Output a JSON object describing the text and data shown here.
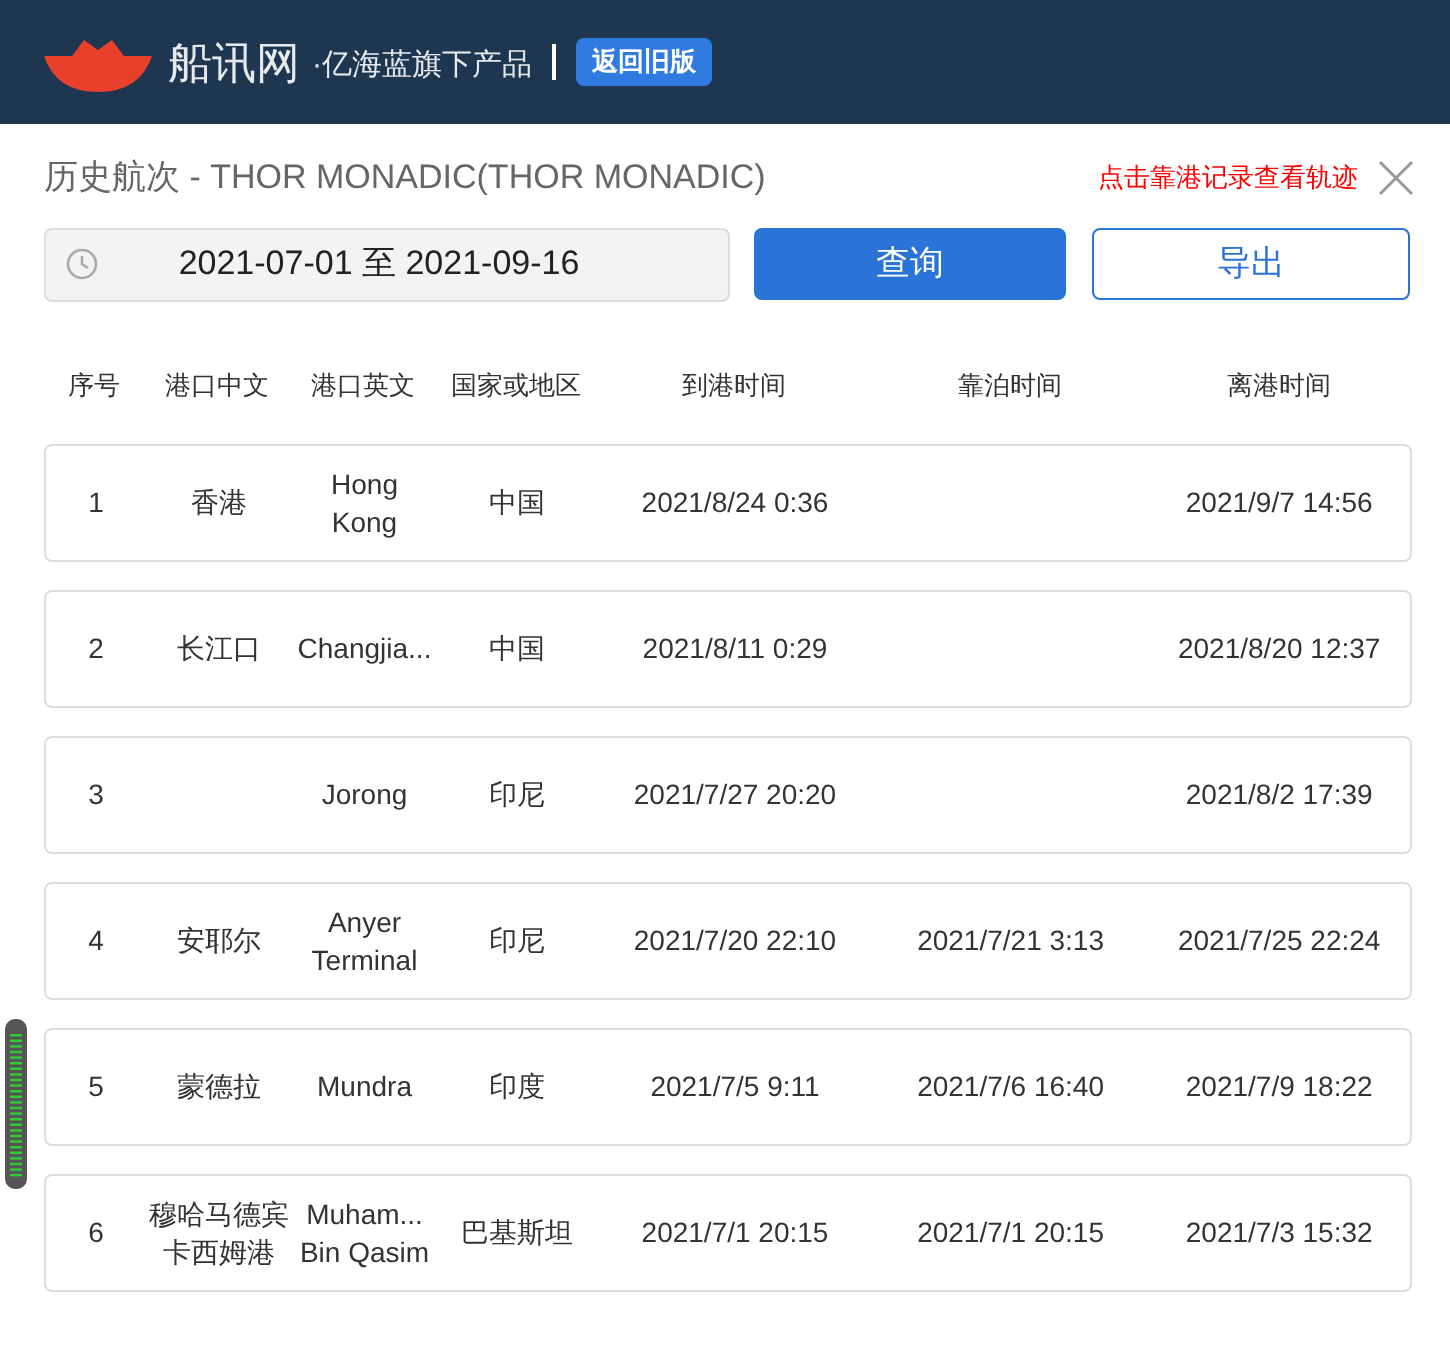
{
  "header": {
    "brand": "船讯网",
    "tagline": "·亿海蓝旗下产品",
    "old_version_button": "返回旧版"
  },
  "title": "历史航次 - THOR MONADIC(THOR MONADIC)",
  "track_hint": "点击靠港记录查看轨迹",
  "date_range": "2021-07-01 至 2021-09-16",
  "query_button": "查询",
  "export_button": "导出",
  "columns": [
    "序号",
    "港口中文",
    "港口英文",
    "国家或地区",
    "到港时间",
    "靠泊时间",
    "离港时间"
  ],
  "rows": [
    [
      "1",
      "香港",
      "Hong\nKong",
      "中国",
      "2021/8/24 0:36",
      "",
      "2021/9/7 14:56"
    ],
    [
      "2",
      "长江口",
      "Changjia...",
      "中国",
      "2021/8/11 0:29",
      "",
      "2021/8/20 12:37"
    ],
    [
      "3",
      "",
      "Jorong",
      "印尼",
      "2021/7/27 20:20",
      "",
      "2021/8/2 17:39"
    ],
    [
      "4",
      "安耶尔",
      "Anyer\nTerminal",
      "印尼",
      "2021/7/20 22:10",
      "2021/7/21 3:13",
      "2021/7/25 22:24"
    ],
    [
      "5",
      "蒙德拉",
      "Mundra",
      "印度",
      "2021/7/5 9:11",
      "2021/7/6 16:40",
      "2021/7/9 18:22"
    ],
    [
      "6",
      "穆哈马德宾卡西姆港",
      "Muham...\nBin Qasim",
      "巴基斯坦",
      "2021/7/1 20:15",
      "2021/7/1 20:15",
      "2021/7/3 15:32"
    ]
  ]
}
